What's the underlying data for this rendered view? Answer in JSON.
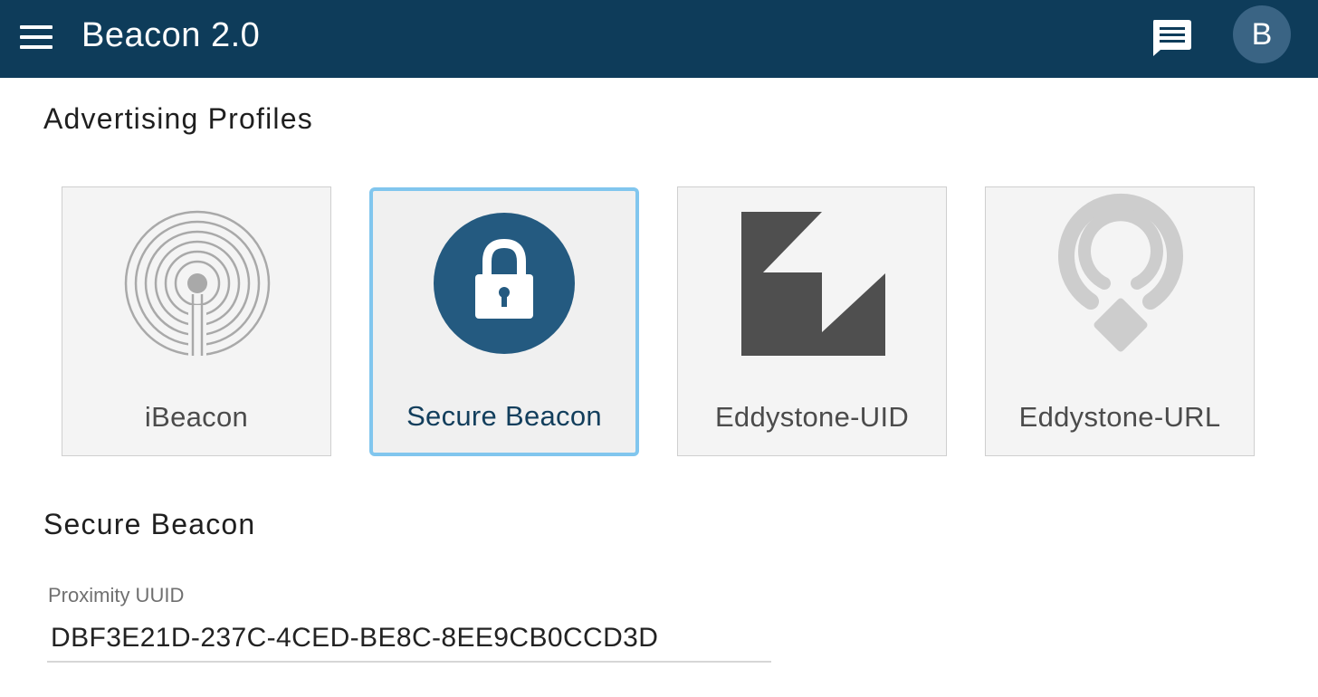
{
  "appbar": {
    "title": "Beacon 2.0",
    "avatar_letter": "B",
    "menu_icon": "hamburger-menu-icon",
    "chat_icon": "chat-icon",
    "background_color": "#0e3c5a"
  },
  "profiles": {
    "title": "Advertising Profiles",
    "cards": [
      {
        "label": "iBeacon",
        "icon": "ibeacon-icon",
        "selected": false
      },
      {
        "label": "Secure Beacon",
        "icon": "lock-icon",
        "selected": true
      },
      {
        "label": "Eddystone-UID",
        "icon": "eddystone-icon",
        "selected": false
      },
      {
        "label": "Eddystone-URL",
        "icon": "eddystone-url-icon",
        "selected": false
      }
    ],
    "selected_border_color": "#81c6ee",
    "lock_circle_color": "#245a80"
  },
  "details": {
    "title": "Secure Beacon",
    "uuid_label": "Proximity UUID",
    "uuid_value": "DBF3E21D-237C-4CED-BE8C-8EE9CB0CCD3D"
  }
}
